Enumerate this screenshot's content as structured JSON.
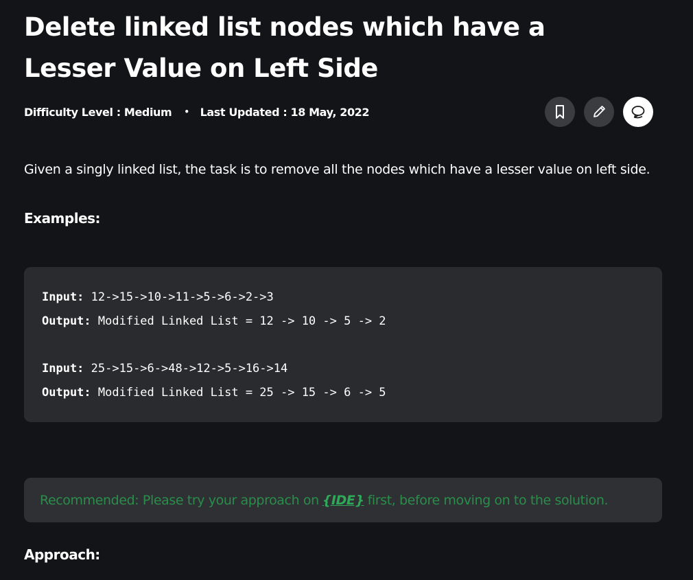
{
  "article": {
    "title": "Delete linked list nodes which have a Lesser Value on Left Side",
    "difficulty": "Difficulty Level : Medium",
    "separator": "•",
    "updated": "Last Updated : 18 May, 2022",
    "intro": "Given a singly linked list, the task is to remove all the nodes which have a lesser value on left side.",
    "examples_label": "Examples:",
    "approach_label": "Approach:"
  },
  "actions": {
    "icons": [
      "bookmark-icon",
      "pencil-icon",
      "chat-icon"
    ]
  },
  "examples": [
    {
      "input_label": "Input:",
      "input_value": " 12->15->10->11->5->6->2->3",
      "output_label": "Output:",
      "output_value": " Modified Linked List = 12 -> 10 -> 5 -> 2"
    },
    {
      "input_label": "Input:",
      "input_value": " 25->15->6->48->12->5->16->14",
      "output_label": "Output:",
      "output_value": " Modified Linked List = 25 -> 15 -> 6 -> 5"
    }
  ],
  "recommendation": {
    "before": "Recommended: Please try your approach on",
    "link": "{IDE}",
    "after": "first, before moving on to the solution."
  },
  "colors": {
    "background": "#131417",
    "code_background": "#2a2b2e",
    "recommend_text": "#2a8e4a"
  }
}
